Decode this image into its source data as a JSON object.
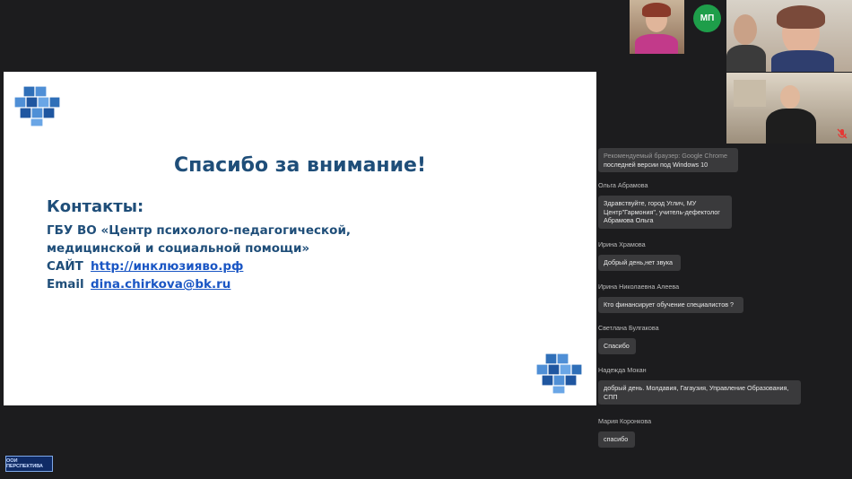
{
  "slide": {
    "title": "Спасибо за внимание!",
    "contacts_heading": "Контакты:",
    "org_line1": "ГБУ ВО «Центр психолого-педагогической,",
    "org_line2": "медицинской и социальной помощи»",
    "site_label": "САЙТ",
    "site_value": "http://инклюзияво.рф",
    "email_label": "Email",
    "email_value": "dina.chirkova@bk.ru"
  },
  "participants": {
    "avatar_initials": "МП"
  },
  "chat": {
    "messages": [
      {
        "name": "",
        "lines": [
          "Рекомендуемый браузер: Google Chrome",
          "последней версии под Windows 10"
        ]
      },
      {
        "name": "Ольга Абрамова",
        "lines": [
          "Здравствуйте, город Углич, МУ",
          "Центр\"Гармония\", учитель-дефектолог",
          "Абрамова Ольга"
        ]
      },
      {
        "name": "Ирина Храмова",
        "lines": [
          "Добрый день,нет звука"
        ]
      },
      {
        "name": "Ирина Николаевна Алеева",
        "lines": [
          "Кто финансирует обучение специалистов ?"
        ]
      },
      {
        "name": "Светлана Булгакова",
        "lines": [
          "Спасибо"
        ]
      },
      {
        "name": "Надежда Мокан",
        "lines": [
          "добрый день. Молдавия, Гагаузия, Управление Образования,",
          "СПП"
        ]
      },
      {
        "name": "Мария Коронкова",
        "lines": [
          "спасибо"
        ]
      }
    ]
  },
  "logo": {
    "text": "ООИ ПЕРСПЕКТИВА"
  },
  "colors": {
    "background": "#1c1c1e",
    "slide_text": "#1f4e79",
    "link": "#1a56c4",
    "avatar": "#1e9e4a",
    "bubble": "#3a3a3c"
  }
}
